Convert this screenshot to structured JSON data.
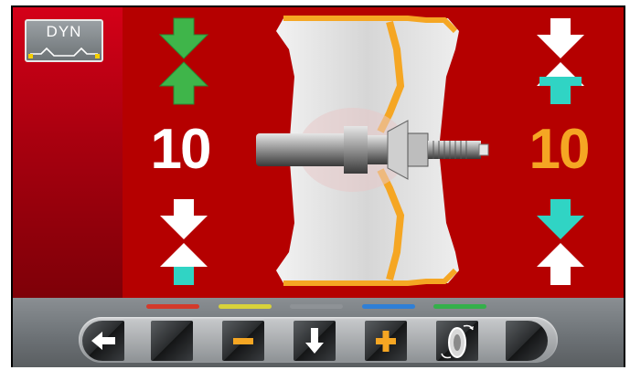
{
  "mode": {
    "label": "DYN"
  },
  "left_plane": {
    "value": "10",
    "value_color": "#ffffff"
  },
  "right_plane": {
    "value": "10",
    "value_color": "#f5a623"
  },
  "colors": {
    "panel": "#b50000",
    "green_arrow": "#3fb54a",
    "cyan_arrow": "#30d4c4",
    "value_orange": "#f5a623"
  },
  "color_keys": [
    "#d33a2b",
    "#d8d23a",
    "#8e9296",
    "#2f7fd6",
    "#34b04a"
  ],
  "toolbar": {
    "buttons": [
      {
        "icon": "back-arrow-icon"
      },
      {
        "icon": "blank"
      },
      {
        "icon": "minus-icon"
      },
      {
        "icon": "down-arrow-icon"
      },
      {
        "icon": "plus-icon"
      },
      {
        "icon": "wheel-spin-icon"
      },
      {
        "icon": "blank"
      }
    ]
  }
}
